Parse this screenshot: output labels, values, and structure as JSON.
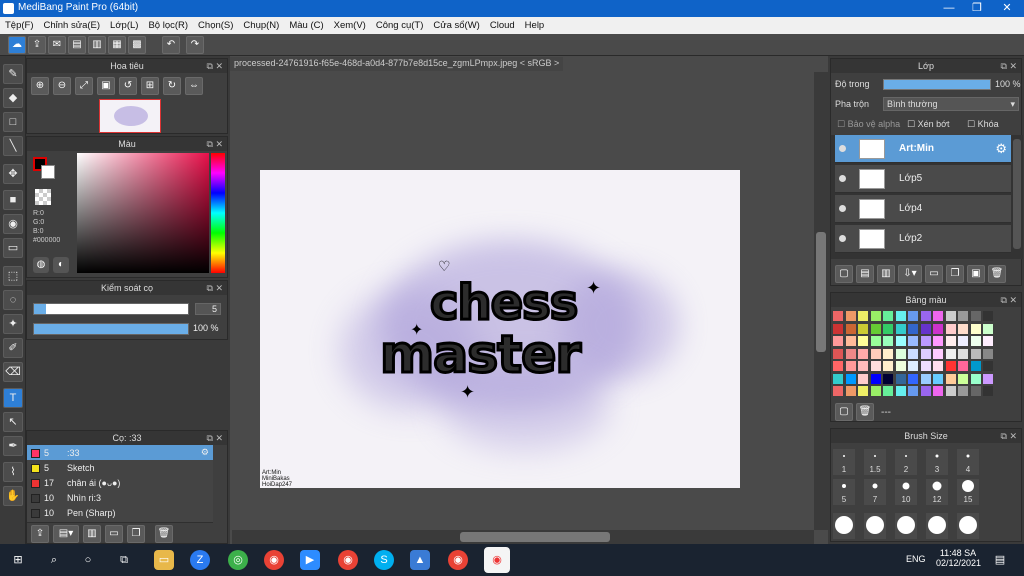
{
  "window": {
    "title": "MediBang Paint Pro (64bit)"
  },
  "menu": [
    "Tệp(F)",
    "Chỉnh sửa(E)",
    "Lớp(L)",
    "Bộ lọc(R)",
    "Chọn(S)",
    "Chụp(N)",
    "Màu (C)",
    "Xem(V)",
    "Công cụ(T)",
    "Cửa sổ(W)",
    "Cloud",
    "Help"
  ],
  "navigator": {
    "title": "Hoa tiêu"
  },
  "color_panel": {
    "title": "Màu",
    "r": "R:0",
    "g": "G:0",
    "b": "B:0",
    "hex": "#000000"
  },
  "brush_control": {
    "title": "Kiểm soát cọ",
    "size": "5",
    "opacity": "100 %"
  },
  "brush_list": {
    "title": "Cọ: :33",
    "items": [
      {
        "size": "5",
        "name": ":33",
        "color": "#ff3366",
        "sel": true
      },
      {
        "size": "5",
        "name": "Sketch",
        "color": "#f4e21c",
        "sel": false
      },
      {
        "size": "17",
        "name": "chân ái (●ᴗ●)",
        "color": "#e33",
        "sel": false
      },
      {
        "size": "10",
        "name": "Nhìn ri:3",
        "color": "#3a3a3a",
        "sel": false
      },
      {
        "size": "10",
        "name": "Pen (Sharp)",
        "color": "#3a3a3a",
        "sel": false
      }
    ]
  },
  "document": {
    "tab": "processed-24761916-f65e-468d-a0d4-877b7e8d15ce_zgmLPmpx.jpeg < sRGB >"
  },
  "artwork": {
    "line1": "chess",
    "line2": "master",
    "sig1": "Art:Min",
    "sig2": "MiniBakas",
    "sig3": "HoiDap247"
  },
  "layer_panel": {
    "title": "Lớp",
    "opacity_label": "Độ trong",
    "opacity_value": "100 %",
    "blend_label": "Pha trộn",
    "blend_value": "Bình thường",
    "alpha_label": "Bảo vệ alpha",
    "clip_label": "Xén bớt",
    "lock_label": "Khóa",
    "layers": [
      {
        "name": "Art:Min",
        "sel": true
      },
      {
        "name": "Lớp5",
        "sel": false
      },
      {
        "name": "Lớp4",
        "sel": false
      },
      {
        "name": "Lớp2",
        "sel": false
      }
    ]
  },
  "palette": {
    "title": "Bảng màu",
    "footer": "---"
  },
  "brush_size": {
    "title": "Brush Size",
    "sizes": [
      "1",
      "1.5",
      "2",
      "3",
      "4",
      "5",
      "7",
      "10",
      "12",
      "15"
    ]
  },
  "taskbar": {
    "lang": "ENG",
    "time": "11:48 SA",
    "date": "02/12/2021"
  },
  "colors": {
    "accent": "#5b9bd5",
    "titlebar": "#0f63c8"
  }
}
